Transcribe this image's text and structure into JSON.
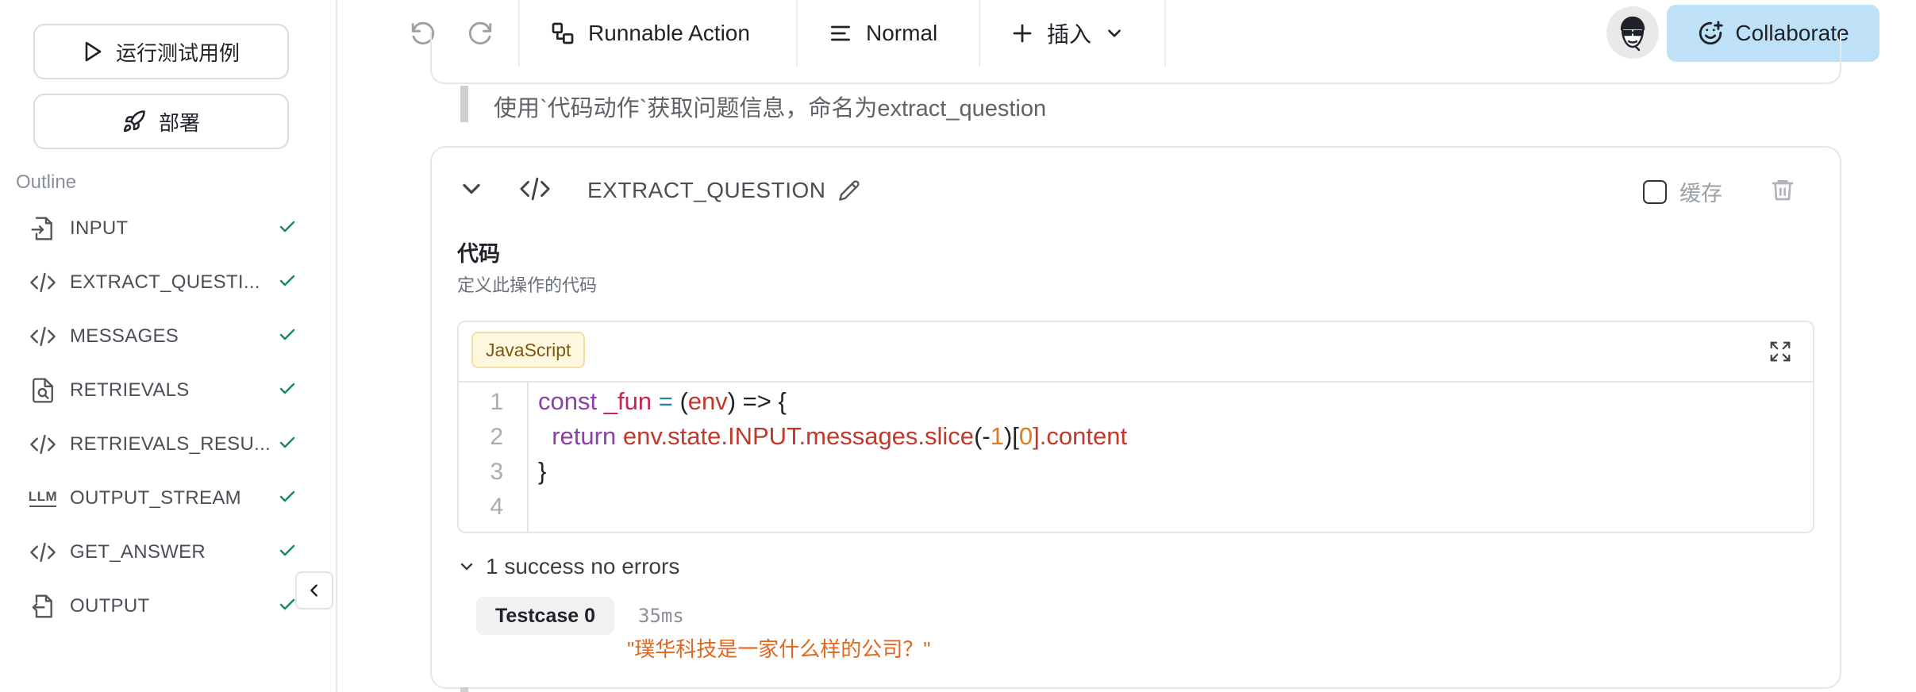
{
  "sidebar": {
    "run_tests_label": "运行测试用例",
    "deploy_label": "部署",
    "outline_heading": "Outline",
    "items": [
      {
        "label": "INPUT",
        "icon": "input-icon"
      },
      {
        "label": "EXTRACT_QUESTI...",
        "icon": "code-icon"
      },
      {
        "label": "MESSAGES",
        "icon": "code-icon"
      },
      {
        "label": "RETRIEVALS",
        "icon": "search-doc-icon"
      },
      {
        "label": "RETRIEVALS_RESU...",
        "icon": "code-icon"
      },
      {
        "label": "OUTPUT_STREAM",
        "icon": "llm-icon"
      },
      {
        "label": "GET_ANSWER",
        "icon": "code-icon"
      },
      {
        "label": "OUTPUT",
        "icon": "output-icon"
      }
    ],
    "llm_icon_text": "LLM"
  },
  "toolbar": {
    "runnable_action_label": "Runnable Action",
    "mode_label": "Normal",
    "insert_label": "插入",
    "collaborate_label": "Collaborate"
  },
  "main": {
    "quote_text": "使用`代码动作`获取问题信息，命名为extract_question",
    "card": {
      "title": "EXTRACT_QUESTION",
      "cache_label": "缓存",
      "section_title": "代码",
      "section_subtitle": "定义此操作的代码",
      "language": "JavaScript",
      "line_numbers": [
        "1",
        "2",
        "3",
        "4"
      ],
      "code": {
        "l1_kw": "const",
        "l1_name": "_fun",
        "l1_eq": "=",
        "l1_open": "(",
        "l1_param": "env",
        "l1_close": ") => {",
        "l2_kw": "return",
        "l2_expr": "env.state.INPUT.messages.slice",
        "l2_open": "(-",
        "l2_num1": "1",
        "l2_mid": ")[",
        "l2_num2": "0",
        "l2_end": "].content",
        "l3": "}"
      },
      "results_summary": "1 success no errors",
      "testcase_label": "Testcase 0",
      "testcase_time": "35ms",
      "testcase_output": "\"璞华科技是一家什么样的公司？\""
    }
  },
  "colors": {
    "accent_check": "#1d8a6a",
    "collaborate_bg": "#bfe1f7",
    "output_orange": "#e3661d"
  }
}
